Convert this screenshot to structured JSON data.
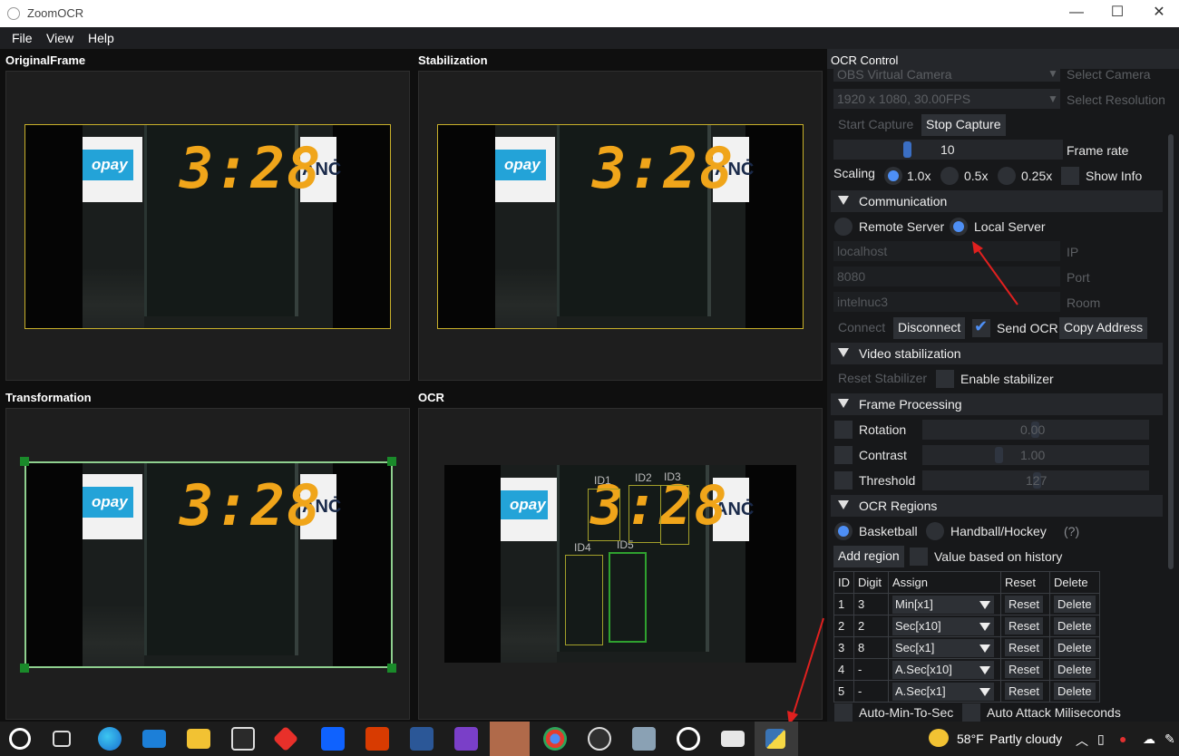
{
  "window": {
    "title": "ZoomOCR",
    "min": "—",
    "max": "☐",
    "close": "✕"
  },
  "menu": {
    "file": "File",
    "view": "View",
    "help": "Help"
  },
  "panels": {
    "original": "OriginalFrame",
    "stabilization": "Stabilization",
    "transformation": "Transformation",
    "ocr": "OCR"
  },
  "scene": {
    "clock": "3:28",
    "ad_left": "pay",
    "ad_left_prefix": "o",
    "ad_right": "ANĊ"
  },
  "ocr_regions_overlay": [
    {
      "label": "ID1"
    },
    {
      "label": "ID2"
    },
    {
      "label": "ID3"
    },
    {
      "label": "ID4"
    },
    {
      "label": "ID5"
    }
  ],
  "control": {
    "header": "OCR Control",
    "camera": {
      "value": "OBS Virtual Camera",
      "label": "Select Camera"
    },
    "resolution": {
      "value": "1920 x 1080, 30.00FPS",
      "label": "Select Resolution"
    },
    "start_capture": "Start Capture",
    "stop_capture": "Stop Capture",
    "frame_rate": {
      "value": "10",
      "label": "Frame rate",
      "level": 0.4
    },
    "scaling": {
      "label": "Scaling",
      "options": [
        "1.0x",
        "0.5x",
        "0.25x"
      ],
      "selected": "1.0x",
      "show_info": "Show Info"
    },
    "communication": {
      "title": "Communication",
      "remote": "Remote Server",
      "local": "Local Server",
      "selected": "Local Server",
      "host": {
        "value": "localhost",
        "label": "IP"
      },
      "port": {
        "value": "8080",
        "label": "Port"
      },
      "room": {
        "value": "intelnuc3",
        "label": "Room"
      },
      "connect": "Connect",
      "disconnect": "Disconnect",
      "send_ocr": "Send OCR",
      "send_ocr_checked": true,
      "copy_address": "Copy Address"
    },
    "video_stabilization": {
      "title": "Video stabilization",
      "reset": "Reset Stabilizer",
      "enable": "Enable stabilizer"
    },
    "frame_processing": {
      "title": "Frame Processing",
      "rotation": {
        "label": "Rotation",
        "value": "0.00",
        "level": 0.5
      },
      "contrast": {
        "label": "Contrast",
        "value": "1.00",
        "level": 0.33
      },
      "threshold": {
        "label": "Threshold",
        "value": "127",
        "level": 0.5
      }
    },
    "ocr_regions": {
      "title": "OCR Regions",
      "basketball": "Basketball",
      "handball": "Handball/Hockey",
      "help": "(?)",
      "selected": "Basketball",
      "add_region": "Add region",
      "history": "Value based on history",
      "columns": [
        "ID",
        "Digit",
        "Assign",
        "Reset",
        "Delete"
      ],
      "rows": [
        {
          "id": "1",
          "digit": "3",
          "assign": "Min[x1]",
          "reset": "Reset",
          "delete": "Delete"
        },
        {
          "id": "2",
          "digit": "2",
          "assign": "Sec[x10]",
          "reset": "Reset",
          "delete": "Delete"
        },
        {
          "id": "3",
          "digit": "8",
          "assign": "Sec[x1]",
          "reset": "Reset",
          "delete": "Delete"
        },
        {
          "id": "4",
          "digit": "-",
          "assign": "A.Sec[x10]",
          "reset": "Reset",
          "delete": "Delete"
        },
        {
          "id": "5",
          "digit": "-",
          "assign": "A.Sec[x1]",
          "reset": "Reset",
          "delete": "Delete"
        }
      ],
      "auto_min": "Auto-Min-To-Sec",
      "auto_attack": "Auto Attack Miliseconds"
    }
  },
  "taskbar": {
    "weather_temp": "58°F",
    "weather_text": "Partly cloudy",
    "apps": [
      "start-icon",
      "task-view-icon",
      "edge-icon",
      "mail-icon",
      "file-explorer-icon",
      "store-icon",
      "app-red-icon",
      "dropbox-icon",
      "office-icon",
      "word-icon",
      "visual-studio-icon",
      "slack-icon",
      "chrome-icon",
      "obs-icon",
      "monitor-icon",
      "media-player-icon",
      "remote-desktop-icon",
      "python-icon"
    ]
  },
  "colors": {
    "accent": "#4e8ff5",
    "clock": "#f0a51a",
    "ocr_box": "#c8b02a",
    "selection": "#8fd08f",
    "arrow": "#e0201f"
  }
}
